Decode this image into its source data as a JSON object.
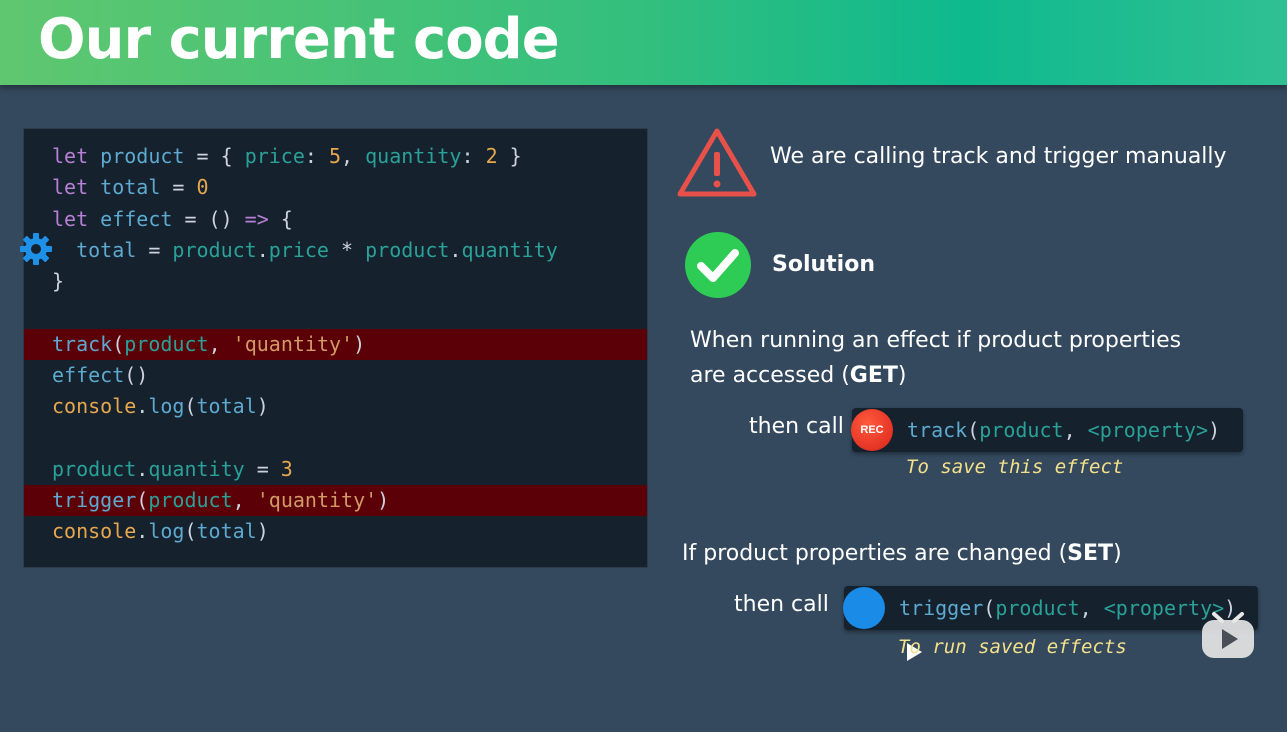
{
  "header": {
    "title": "Our current code"
  },
  "code": {
    "lines": [
      [
        {
          "t": "let ",
          "c": "k"
        },
        {
          "t": "product",
          "c": "v"
        },
        {
          "t": " = { ",
          "c": "o"
        },
        {
          "t": "price",
          "c": "p"
        },
        {
          "t": ": ",
          "c": "o"
        },
        {
          "t": "5",
          "c": "n"
        },
        {
          "t": ", ",
          "c": "o"
        },
        {
          "t": "quantity",
          "c": "p"
        },
        {
          "t": ": ",
          "c": "o"
        },
        {
          "t": "2",
          "c": "n"
        },
        {
          "t": " }",
          "c": "o"
        }
      ],
      [
        {
          "t": "let ",
          "c": "k"
        },
        {
          "t": "total",
          "c": "v"
        },
        {
          "t": " = ",
          "c": "o"
        },
        {
          "t": "0",
          "c": "n"
        }
      ],
      [
        {
          "t": "let ",
          "c": "k"
        },
        {
          "t": "effect",
          "c": "v"
        },
        {
          "t": " = () ",
          "c": "o"
        },
        {
          "t": "=>",
          "c": "k"
        },
        {
          "t": " {",
          "c": "o"
        }
      ],
      [
        {
          "t": "  total",
          "c": "v"
        },
        {
          "t": " = ",
          "c": "o"
        },
        {
          "t": "product",
          "c": "p"
        },
        {
          "t": ".",
          "c": "o"
        },
        {
          "t": "price",
          "c": "p"
        },
        {
          "t": " * ",
          "c": "o"
        },
        {
          "t": "product",
          "c": "p"
        },
        {
          "t": ".",
          "c": "o"
        },
        {
          "t": "quantity",
          "c": "p"
        }
      ],
      [
        {
          "t": "}",
          "c": "o"
        }
      ],
      [],
      [
        {
          "t": "track",
          "c": "f"
        },
        {
          "t": "(",
          "c": "o"
        },
        {
          "t": "product",
          "c": "p"
        },
        {
          "t": ", ",
          "c": "o"
        },
        {
          "t": "'quantity'",
          "c": "s"
        },
        {
          "t": ")",
          "c": "o"
        }
      ],
      [
        {
          "t": "effect",
          "c": "f"
        },
        {
          "t": "()",
          "c": "o"
        }
      ],
      [
        {
          "t": "console",
          "c": "n"
        },
        {
          "t": ".",
          "c": "o"
        },
        {
          "t": "log",
          "c": "f"
        },
        {
          "t": "(",
          "c": "o"
        },
        {
          "t": "total",
          "c": "v"
        },
        {
          "t": ")",
          "c": "o"
        }
      ],
      [],
      [
        {
          "t": "product",
          "c": "p"
        },
        {
          "t": ".",
          "c": "o"
        },
        {
          "t": "quantity",
          "c": "p"
        },
        {
          "t": " = ",
          "c": "o"
        },
        {
          "t": "3",
          "c": "n"
        }
      ],
      [
        {
          "t": "trigger",
          "c": "f"
        },
        {
          "t": "(",
          "c": "o"
        },
        {
          "t": "product",
          "c": "p"
        },
        {
          "t": ", ",
          "c": "o"
        },
        {
          "t": "'quantity'",
          "c": "s"
        },
        {
          "t": ")",
          "c": "o"
        }
      ],
      [
        {
          "t": "console",
          "c": "n"
        },
        {
          "t": ".",
          "c": "o"
        },
        {
          "t": "log",
          "c": "f"
        },
        {
          "t": "(",
          "c": "o"
        },
        {
          "t": "total",
          "c": "v"
        },
        {
          "t": ")",
          "c": "o"
        }
      ]
    ],
    "highlighted": [
      6,
      11
    ]
  },
  "warning": {
    "text": "We are calling track and trigger manually"
  },
  "solution": {
    "label": "Solution",
    "get_line1": "When running an effect if product properties",
    "get_line2_pre": "are accessed (",
    "get_line2_bold": "GET",
    "get_line2_post": ")",
    "then_call": "then call",
    "rec_label": "REC",
    "track_code": [
      {
        "t": "track",
        "c": "f"
      },
      {
        "t": "(",
        "c": "o"
      },
      {
        "t": "product",
        "c": "p"
      },
      {
        "t": ", ",
        "c": "o"
      },
      {
        "t": "<property>",
        "c": "p"
      },
      {
        "t": ")",
        "c": "o"
      }
    ],
    "track_note": "To save this effect",
    "set_line_pre": "If product properties are changed (",
    "set_line_bold": "SET",
    "set_line_post": ")",
    "trigger_code": [
      {
        "t": "trigger",
        "c": "f"
      },
      {
        "t": "(",
        "c": "o"
      },
      {
        "t": "product",
        "c": "p"
      },
      {
        "t": ", ",
        "c": "o"
      },
      {
        "t": "<property>",
        "c": "p"
      },
      {
        "t": ")",
        "c": "o"
      }
    ],
    "trigger_note": "To run saved effects"
  },
  "colors": {
    "background": "#34495e",
    "code_bg": "#15212d",
    "highlight": "#5c0007",
    "warning_red": "#e8514a",
    "success_green": "#2ecc55",
    "note_yellow": "#f3e08a"
  }
}
